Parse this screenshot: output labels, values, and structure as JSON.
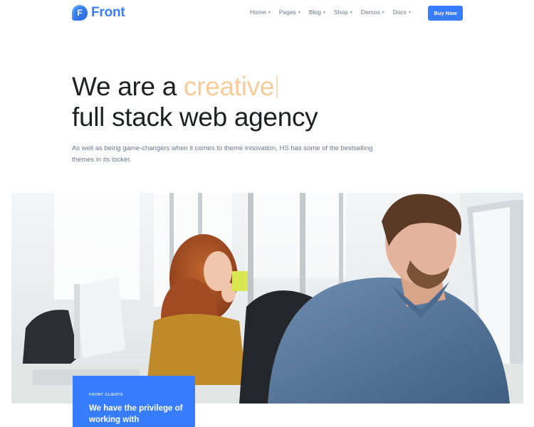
{
  "brand": {
    "name": "Front",
    "mark_letter": "F",
    "color": "#377dff"
  },
  "nav": {
    "items": [
      {
        "label": "Home"
      },
      {
        "label": "Pages"
      },
      {
        "label": "Blog"
      },
      {
        "label": "Shop"
      },
      {
        "label": "Demos"
      },
      {
        "label": "Docs"
      }
    ],
    "cta": "Buy Now"
  },
  "hero": {
    "title_prefix": "We are a ",
    "title_accent": "creative",
    "title_line2": "full stack web agency",
    "description": "As well as being game-changers when it comes to theme innovation, HS has some of the bestselling themes in its locker.",
    "accent_color": "#f6cd9a"
  },
  "image": {
    "icon": "office-workers-photo"
  },
  "clients_card": {
    "kicker": "FRONT CLIENTS",
    "heading": "We have the privilege of working with"
  }
}
